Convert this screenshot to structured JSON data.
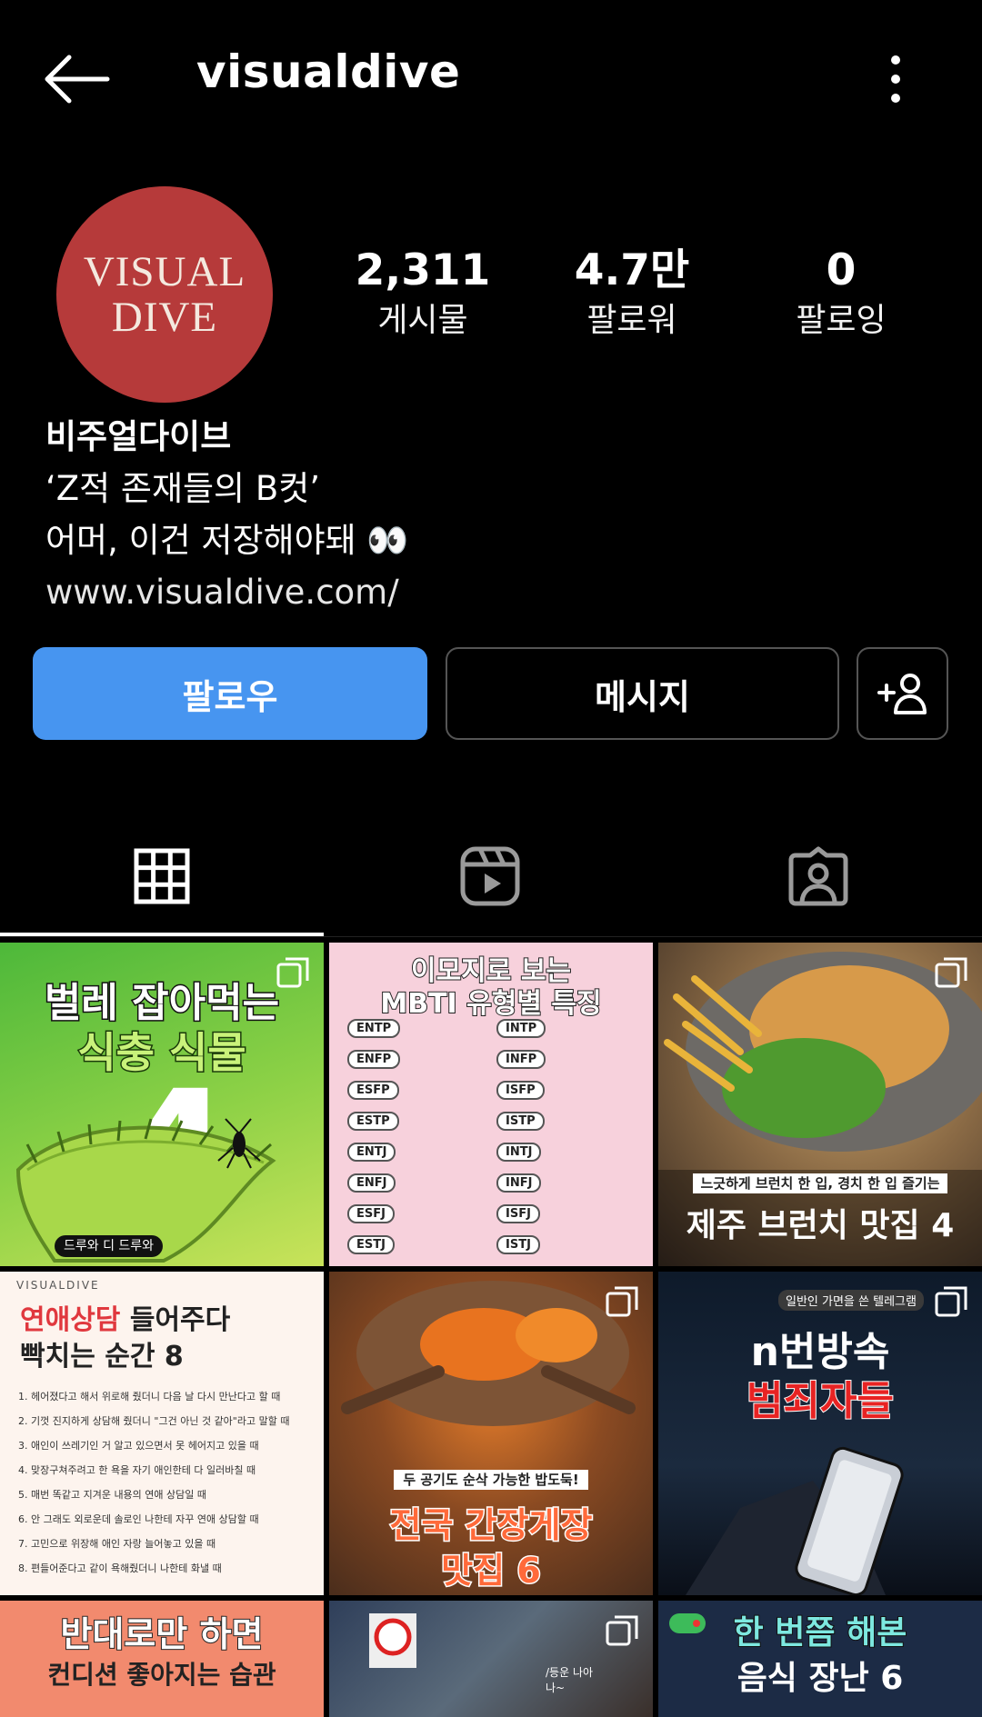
{
  "header": {
    "username": "visualdive"
  },
  "profile": {
    "avatar_text": [
      "VISUAL",
      "DIVE"
    ],
    "brand_color": "#b63a3a",
    "stats": [
      {
        "count": "2,311",
        "label": "게시물"
      },
      {
        "count": "4.7만",
        "label": "팔로워"
      },
      {
        "count": "0",
        "label": "팔로잉"
      }
    ],
    "bio": {
      "name": "비주얼다이브",
      "line1": "‘Z적 존재들의 B컷’",
      "line2": "어머, 이건 저장해야돼 👀",
      "link": "www.visualdive.com/"
    }
  },
  "actions": {
    "follow_label": "팔로우",
    "message_label": "메시지",
    "accent": "#4795f0"
  },
  "tabs": [
    {
      "name": "posts",
      "icon": "grid-icon",
      "active": true
    },
    {
      "name": "reels",
      "icon": "reels-icon",
      "active": false
    },
    {
      "name": "tagged",
      "icon": "tagged-person-icon",
      "active": false
    }
  ],
  "posts": [
    {
      "title1": "벌레 잡아먹는",
      "title2": "식충 식물",
      "number": "4",
      "tag": "드루와 디 드루와"
    },
    {
      "title1": "이모지로 보는",
      "title2": "MBTI 유형별 특징",
      "types_left": [
        "ENTP",
        "ENFP",
        "ESFP",
        "ESTP",
        "ENTJ",
        "ENFJ",
        "ESFJ",
        "ESTJ"
      ],
      "types_right": [
        "INTP",
        "INFP",
        "ISFP",
        "ISTP",
        "INTJ",
        "INFJ",
        "ISFJ",
        "ISTJ"
      ]
    },
    {
      "subtitle": "느긋하게 브런치 한 입, 경치 한 입 즐기는",
      "title": "제주 브런치 맛집 4"
    },
    {
      "brand": "VISUALDIVE",
      "title1a": "연애상담",
      "title1b": " 들어주다",
      "title2": "빡치는 순간 8",
      "items": [
        "1. 헤어졌다고 해서 위로해 줬더니 다음 날 다시 만난다고 할 때",
        "2. 기껏 진지하게 상담해 줬더니 \"그건 아닌 것 같아\"라고 말할 때",
        "3. 애인이 쓰레기인 거 알고 있으면서 못 헤어지고 있을 때",
        "4. 맞장구쳐주려고 한 욕을 자기 애인한테 다 일러바칠 때",
        "5. 매번 똑같고 지겨운 내용의 연애 상담일 때",
        "6. 안 그래도 외로운데 솔로인 나한테 자꾸 연애 상담할 때",
        "7. 고민으로 위장해 애인 자랑 늘어놓고 있을 때",
        "8. 편들어준다고 같이 욕해줬더니 나한테 화낼 때"
      ]
    },
    {
      "subtitle": "두 공기도 순삭 가능한 밥도둑!",
      "title1": "전국 간장게장",
      "title2": "맛집 6"
    },
    {
      "subtitle": "일반인 가면을 쓴 텔레그램",
      "title1": "n번방속",
      "title2": "범죄자들"
    },
    {
      "title1": "반대로만 하면",
      "title2": "컨디션 좋아지는 습관"
    },
    {
      "caption": "/등운 나아 나~"
    },
    {
      "title1": "한 번쯤 해본",
      "title2": "음식 장난 6"
    }
  ]
}
